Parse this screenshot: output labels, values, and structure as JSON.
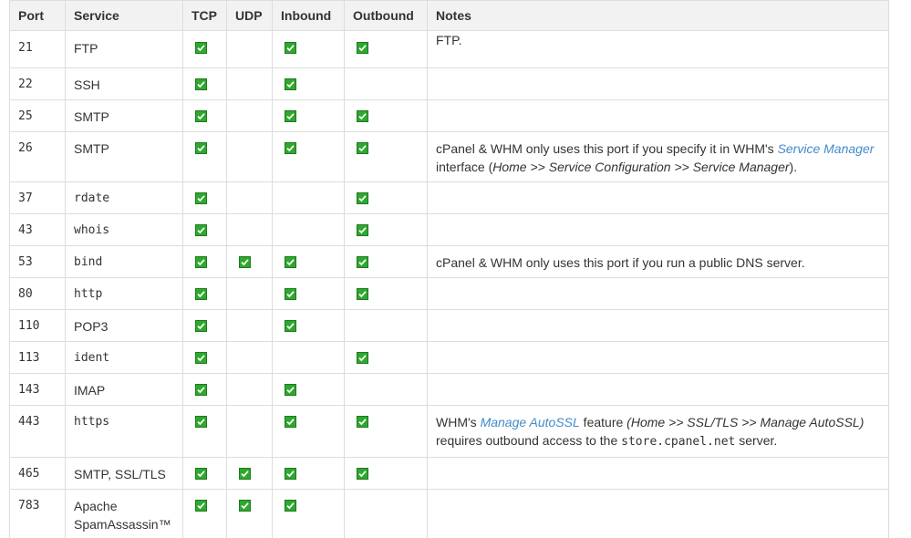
{
  "headers": {
    "port": "Port",
    "service": "Service",
    "tcp": "TCP",
    "udp": "UDP",
    "inbound": "Inbound",
    "outbound": "Outbound",
    "notes": "Notes"
  },
  "icons": {
    "check": "green-checkbox-icon",
    "check_color": "#2ea82e"
  },
  "rows": [
    {
      "port": "21",
      "service": "FTP",
      "tcp": true,
      "udp": false,
      "inbound": true,
      "outbound": true
    },
    {
      "port": "22",
      "service": "SSH",
      "tcp": true,
      "udp": false,
      "inbound": true,
      "outbound": false
    },
    {
      "port": "25",
      "service": "SMTP",
      "tcp": true,
      "udp": false,
      "inbound": true,
      "outbound": true
    },
    {
      "port": "26",
      "service": "SMTP",
      "tcp": true,
      "udp": false,
      "inbound": true,
      "outbound": true
    },
    {
      "port": "37",
      "service": "rdate",
      "tcp": true,
      "udp": false,
      "inbound": false,
      "outbound": true
    },
    {
      "port": "43",
      "service": "whois",
      "tcp": true,
      "udp": false,
      "inbound": false,
      "outbound": true
    },
    {
      "port": "53",
      "service": "bind",
      "tcp": true,
      "udp": true,
      "inbound": true,
      "outbound": true
    },
    {
      "port": "80",
      "service": "http",
      "tcp": true,
      "udp": false,
      "inbound": true,
      "outbound": true
    },
    {
      "port": "110",
      "service": "POP3",
      "tcp": true,
      "udp": false,
      "inbound": true,
      "outbound": false
    },
    {
      "port": "113",
      "service": "ident",
      "tcp": true,
      "udp": false,
      "inbound": false,
      "outbound": true
    },
    {
      "port": "143",
      "service": "IMAP",
      "tcp": true,
      "udp": false,
      "inbound": true,
      "outbound": false
    },
    {
      "port": "443",
      "service": "https",
      "tcp": true,
      "udp": false,
      "inbound": true,
      "outbound": true
    },
    {
      "port": "465",
      "service": "SMTP, SSL/TLS",
      "tcp": true,
      "udp": true,
      "inbound": true,
      "outbound": true
    },
    {
      "port": "783",
      "service": "Apache SpamAssassin™",
      "tcp": true,
      "udp": true,
      "inbound": true,
      "outbound": false
    }
  ],
  "notes": {
    "ftp_tail": "FTP.",
    "port26": {
      "text1": "cPanel & WHM only uses this port if you specify it in WHM's ",
      "link": "Service Manager",
      "text2": " interface (",
      "path": "Home >> Service Configuration >> Service Manager",
      "text3": ")."
    },
    "port53": "cPanel & WHM only uses this port if you run a public DNS server.",
    "port443": {
      "text1": "WHM's ",
      "link": "Manage AutoSSL",
      "text2": " feature ",
      "path": "(Home >> SSL/TLS >> Manage AutoSSL)",
      "text3": " requires outbound access to the ",
      "code": "store.cpanel.net",
      "text4": " server."
    }
  }
}
